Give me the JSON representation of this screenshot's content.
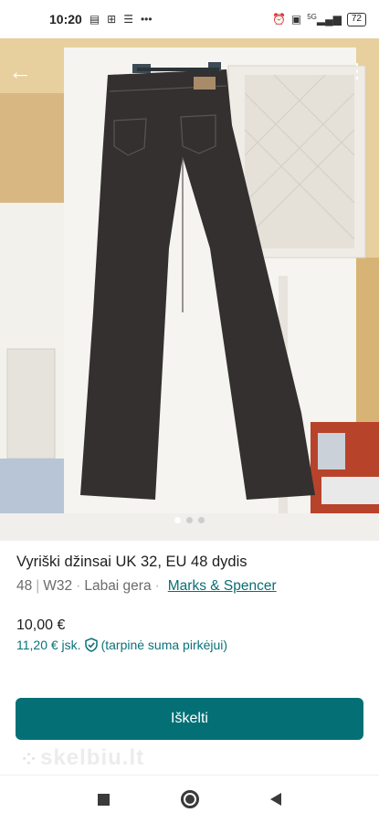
{
  "status_bar": {
    "time": "10:20",
    "left_icons": [
      "sim-card-icon",
      "grid-icon",
      "list-icon",
      "more-dots-icon"
    ],
    "right_icons": [
      "alarm-icon",
      "volte-icon",
      "signal-icon"
    ],
    "signal_label": "5G",
    "battery": "72"
  },
  "photo": {
    "image_count": 3,
    "active_index": 0
  },
  "listing": {
    "title": "Vyriški džinsai UK 32, EU 48 dydis",
    "size": "48",
    "waist": "W32",
    "condition": "Labai gera",
    "brand": "Marks & Spencer",
    "price": "10,00 €",
    "buyer_price": "11,20 € jsk.",
    "buyer_note": "(tarpinė suma pirkėjui)"
  },
  "actions": {
    "primary_button": "Iškelti"
  },
  "watermark": "skelbiu.lt",
  "colors": {
    "accent": "#047076",
    "link": "#0a6e75"
  }
}
